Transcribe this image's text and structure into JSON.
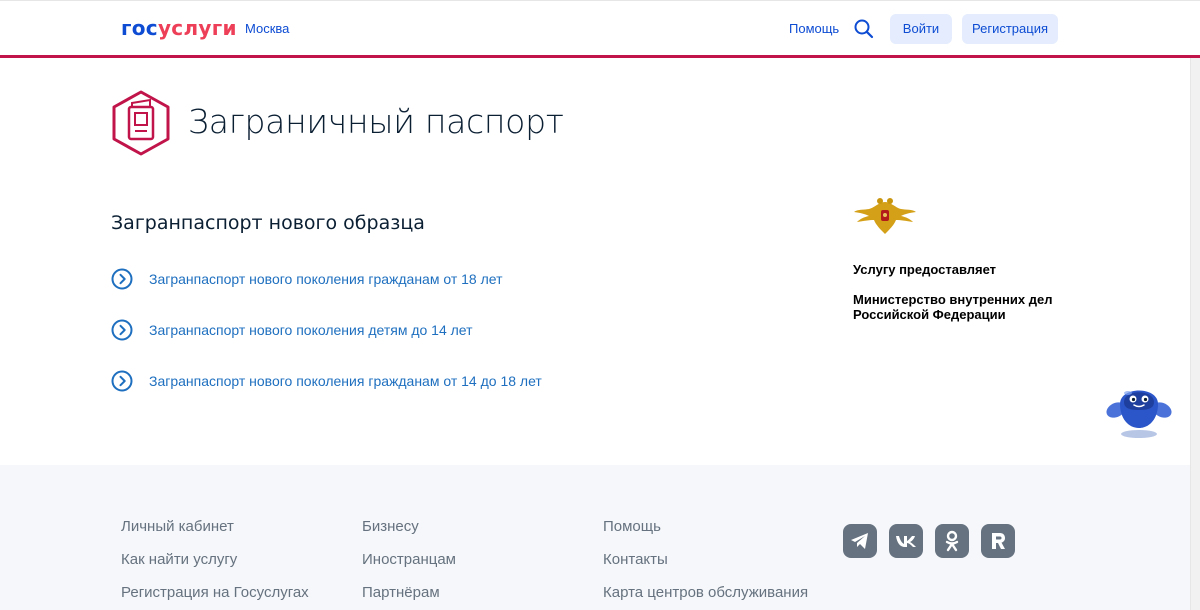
{
  "header": {
    "logo_part1": "гос",
    "logo_part2": "услуги",
    "city": "Москва",
    "help": "Помощь",
    "login": "Войти",
    "register": "Регистрация",
    "search_icon": "search-icon"
  },
  "colors": {
    "brand_blue": "#0d4cd3",
    "brand_red": "#ee3f58",
    "accent_line": "#c0144a",
    "link": "#1e6fbf",
    "footer_bg": "#f5f7fa"
  },
  "main": {
    "title": "Заграничный паспорт",
    "section_title": "Загранпаспорт нового образца",
    "links": [
      {
        "label": "Загранпаспорт нового поколения гражданам от 18 лет"
      },
      {
        "label": "Загранпаспорт нового поколения детям до 14 лет"
      },
      {
        "label": "Загранпаспорт нового поколения гражданам от 14 до 18 лет"
      }
    ]
  },
  "provider": {
    "label": "Услугу предоставляет",
    "name": "Министерство внутренних дел Российской Федерации"
  },
  "footer": {
    "col1": [
      "Личный кабинет",
      "Как найти услугу",
      "Регистрация на Госуслугах"
    ],
    "col2": [
      "Бизнесу",
      "Иностранцам",
      "Партнёрам"
    ],
    "col3": [
      "Помощь",
      "Контакты",
      "Карта центров обслуживания"
    ],
    "social": [
      "telegram-icon",
      "vk-icon",
      "odnoklassniki-icon",
      "rutube-icon"
    ]
  }
}
